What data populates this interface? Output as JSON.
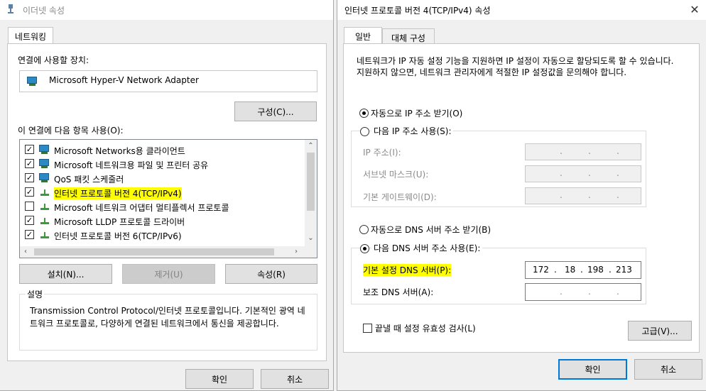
{
  "left": {
    "title": "이더넷 속성",
    "tab": "네트워킹",
    "connect_using_label": "연결에 사용할 장치:",
    "adapter_name": "Microsoft Hyper-V Network Adapter",
    "configure_button": "구성(C)...",
    "items_label": "이 연결에 다음 항목 사용(O):",
    "items": [
      {
        "label": "Microsoft Networks용 클라이언트",
        "checked": true,
        "icon": "network-client-icon"
      },
      {
        "label": "Microsoft 네트워크용 파일 및 프린터 공유",
        "checked": true,
        "icon": "network-service-icon"
      },
      {
        "label": "QoS 패킷 스케줄러",
        "checked": true,
        "icon": "network-service-icon"
      },
      {
        "label": "인터넷 프로토콜 버전 4(TCP/IPv4)",
        "checked": true,
        "icon": "protocol-icon",
        "highlighted": true
      },
      {
        "label": "Microsoft 네트워크 어댑터 멀티플렉서 프로토콜",
        "checked": false,
        "icon": "protocol-icon"
      },
      {
        "label": "Microsoft LLDP 프로토콜 드라이버",
        "checked": true,
        "icon": "protocol-icon"
      },
      {
        "label": "인터넷 프로토콜 버전 6(TCP/IPv6)",
        "checked": true,
        "icon": "protocol-icon"
      }
    ],
    "install_button": "설치(N)...",
    "uninstall_button": "제거(U)",
    "properties_button": "속성(R)",
    "description_label": "설명",
    "description_text": "Transmission Control Protocol/인터넷 프로토콜입니다. 기본적인 광역 네트워크 프로토콜로, 다양하게 연결된 네트워크에서 통신을 제공합니다.",
    "ok_button": "확인",
    "cancel_button": "취소"
  },
  "right": {
    "title": "인터넷 프로토콜 버전 4(TCP/IPv4) 속성",
    "tabs": [
      "일반",
      "대체 구성"
    ],
    "intro_text": "네트워크가 IP 자동 설정 기능을 지원하면 IP 설정이 자동으로 할당되도록 할 수 있습니다. 지원하지 않으면, 네트워크 관리자에게 적절한 IP 설정값을 문의해야 합니다.",
    "ip_auto_label": "자동으로 IP 주소 받기(O)",
    "ip_manual_label": "다음 IP 주소 사용(S):",
    "ip_address_label": "IP 주소(I):",
    "subnet_label": "서브넷 마스크(U):",
    "gateway_label": "기본 게이트웨이(D):",
    "dns_auto_label": "자동으로 DNS 서버 주소 받기(B)",
    "dns_manual_label": "다음 DNS 서버 주소 사용(E):",
    "dns_preferred_label": "기본 설정 DNS 서버(P):",
    "dns_preferred_octets": [
      "172",
      "18",
      "198",
      "213"
    ],
    "dns_alternate_label": "보조 DNS 서버(A):",
    "validate_label": "끝낼 때 설정 유효성 검사(L)",
    "advanced_button": "고급(V)...",
    "ok_button": "확인",
    "cancel_button": "취소"
  },
  "colors": {
    "highlight": "#ffff00",
    "accent": "#0078d7"
  }
}
